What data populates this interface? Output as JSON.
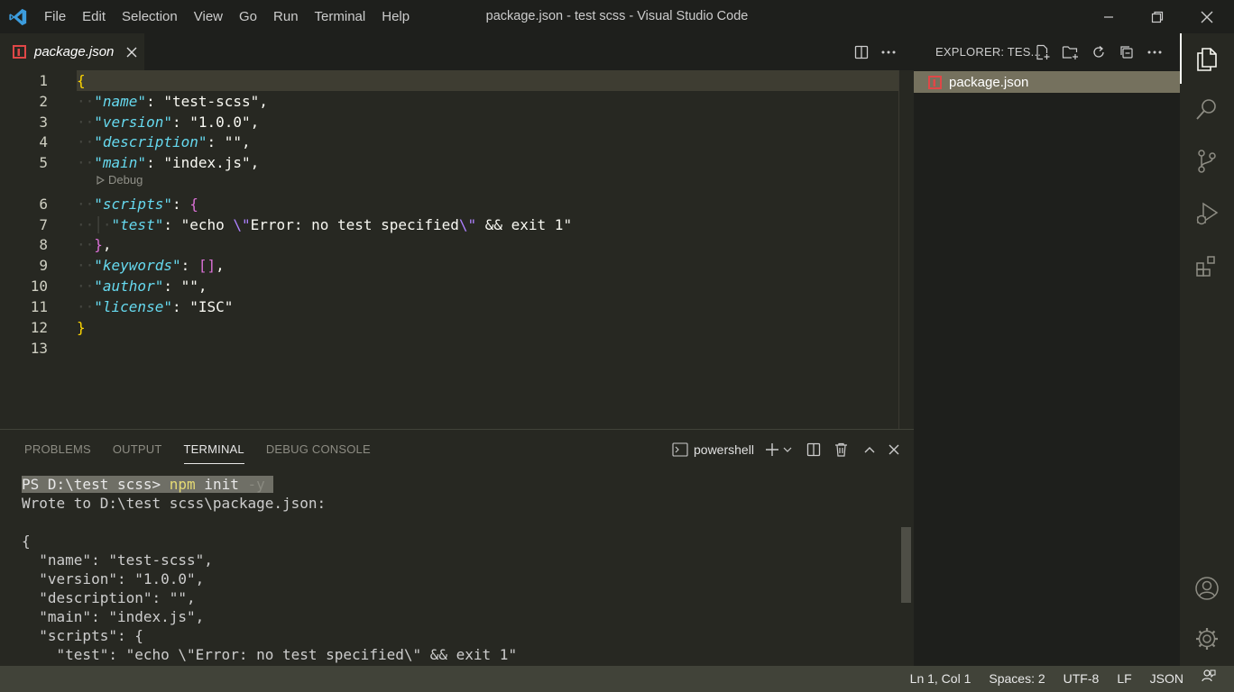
{
  "menu": [
    "File",
    "Edit",
    "Selection",
    "View",
    "Go",
    "Run",
    "Terminal",
    "Help"
  ],
  "window_title": "package.json - test scss - Visual Studio Code",
  "tab": {
    "filename": "package.json"
  },
  "editor": {
    "line_numbers": [
      "1",
      "2",
      "3",
      "4",
      "5",
      "6",
      "7",
      "8",
      "9",
      "10",
      "11",
      "12",
      "13"
    ],
    "codelens": "Debug",
    "lines": {
      "l1_open": "{",
      "name_key": "\"name\"",
      "name_val": "\"test-scss\"",
      "version_key": "\"version\"",
      "version_val": "\"1.0.0\"",
      "description_key": "\"description\"",
      "description_val": "\"\"",
      "main_key": "\"main\"",
      "main_val": "\"index.js\"",
      "scripts_key": "\"scripts\"",
      "scripts_open": "{",
      "test_key": "\"test\"",
      "test_val_a": "\"echo ",
      "test_esc_1": "\\\"",
      "test_val_b": "Error: no test specified",
      "test_esc_2": "\\\"",
      "test_val_c": " && exit 1\"",
      "scripts_close": "}",
      "keywords_key": "\"keywords\"",
      "keywords_val": "[]",
      "author_key": "\"author\"",
      "author_val": "\"\"",
      "license_key": "\"license\"",
      "license_val": "\"ISC\"",
      "l12_close": "}"
    }
  },
  "panel": {
    "tabs": [
      "PROBLEMS",
      "OUTPUT",
      "TERMINAL",
      "DEBUG CONSOLE"
    ],
    "active_tab": "TERMINAL",
    "shell": "powershell",
    "terminal": {
      "prompt": "PS D:\\test scss> ",
      "command": "npm",
      "args": " init",
      "ghost": " -y",
      "output": [
        "Wrote to D:\\test scss\\package.json:",
        "",
        "{",
        "  \"name\": \"test-scss\",",
        "  \"version\": \"1.0.0\",",
        "  \"description\": \"\",",
        "  \"main\": \"index.js\",",
        "  \"scripts\": {",
        "    \"test\": \"echo \\\"Error: no test specified\\\" && exit 1\""
      ]
    }
  },
  "explorer": {
    "title": "EXPLORER: TES...",
    "files": [
      "package.json"
    ]
  },
  "statusbar": {
    "position": "Ln 1, Col 1",
    "spaces": "Spaces: 2",
    "encoding": "UTF-8",
    "eol": "LF",
    "language": "JSON"
  },
  "colors": {
    "accent_icon": "#3c9cdd",
    "json_icon": "#e04747"
  }
}
